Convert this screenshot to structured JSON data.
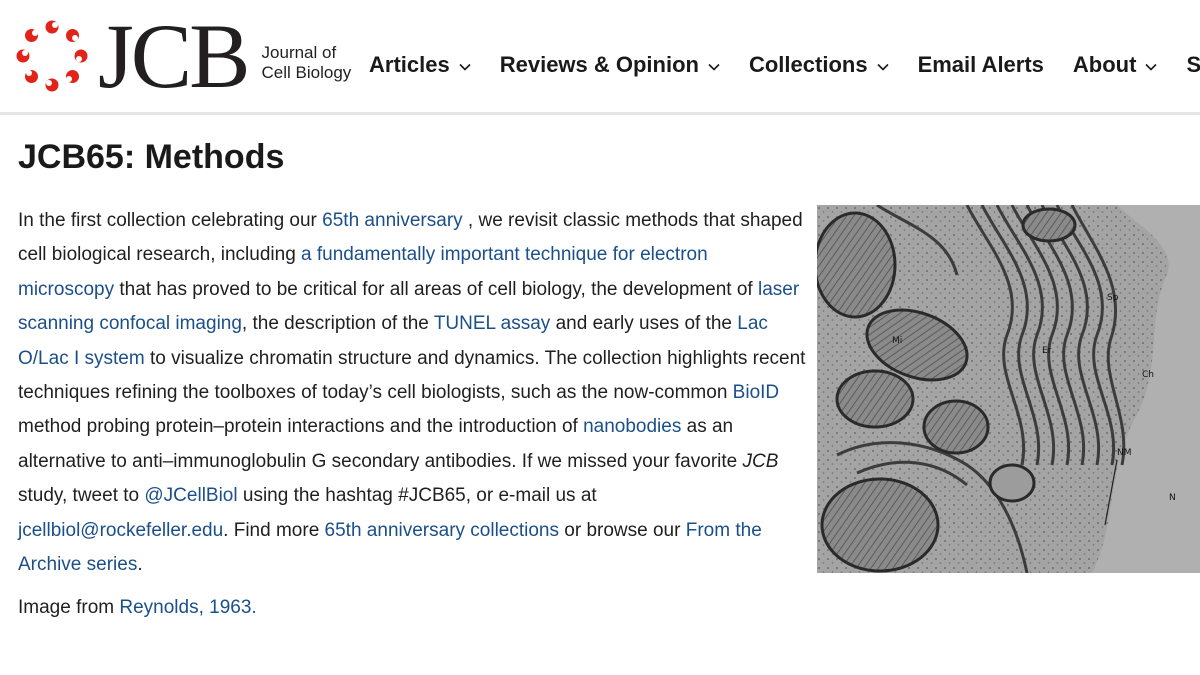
{
  "header": {
    "logo_text": "JCB",
    "logo_subtitle_line1": "Journal of",
    "logo_subtitle_line2": "Cell Biology",
    "nav": [
      {
        "label": "Articles",
        "has_dropdown": true
      },
      {
        "label": "Reviews & Opinion",
        "has_dropdown": true
      },
      {
        "label": "Collections",
        "has_dropdown": true
      },
      {
        "label": "Email Alerts",
        "has_dropdown": false
      },
      {
        "label": "About",
        "has_dropdown": true
      },
      {
        "label": "Su",
        "has_dropdown": false
      }
    ]
  },
  "page": {
    "title": "JCB65: Methods",
    "paragraph": [
      {
        "t": "In the first collection celebrating our "
      },
      {
        "t": "65th anniversary",
        "link": true
      },
      {
        "t": " , we revisit classic methods that shaped cell biological research, including "
      },
      {
        "t": "a fundamentally important technique for electron microscopy",
        "link": true
      },
      {
        "t": " that has proved to be critical for all areas of cell biology, the development of "
      },
      {
        "t": "laser scanning confocal imaging",
        "link": true
      },
      {
        "t": ", the description of the "
      },
      {
        "t": "TUNEL assay",
        "link": true
      },
      {
        "t": " and early uses of the "
      },
      {
        "t": "Lac O/Lac I system",
        "link": true
      },
      {
        "t": " to visualize chromatin structure and dynamics. The collection highlights recent techniques refining the toolboxes of today’s cell biologists, such as the now-common "
      },
      {
        "t": "BioID",
        "link": true
      },
      {
        "t": " method probing protein–protein interactions and the introduction of "
      },
      {
        "t": "nanobodies",
        "link": true
      },
      {
        "t": " as an alternative to anti–immunoglobulin G secondary antibodies. If we missed your favorite "
      },
      {
        "t": "JCB",
        "italic": true
      },
      {
        "t": " study, tweet to "
      },
      {
        "t": "@JCellBiol",
        "link": true
      },
      {
        "t": " using the hashtag #JCB65, or e-mail us at "
      },
      {
        "t": "jcellbiol@rockefeller.edu",
        "link": true
      },
      {
        "t": ". Find more "
      },
      {
        "t": "65th anniversary collections",
        "link": true
      },
      {
        "t": " or browse our "
      },
      {
        "t": "From the Archive series",
        "link": true
      },
      {
        "t": "."
      }
    ],
    "caption_prefix": "Image from ",
    "caption_link": "Reynolds, 1963."
  },
  "figure": {
    "labels": {
      "mi": "Mi",
      "er": "Er",
      "sp": "Sp",
      "ch": "Ch",
      "nm": "NM",
      "n": "N"
    }
  },
  "colors": {
    "link": "#1b4f8a",
    "logo_red": "#e2231a",
    "text": "#1a1a1a"
  }
}
